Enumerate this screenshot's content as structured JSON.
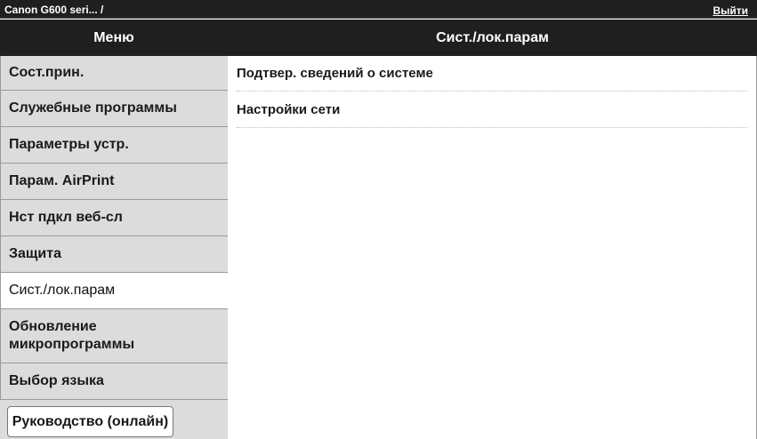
{
  "topbar": {
    "breadcrumb": "Canon G600 seri... /",
    "logout_label": "Выйти"
  },
  "header": {
    "menu_title": "Меню",
    "page_title": "Сист./лок.парам"
  },
  "sidebar": {
    "items": [
      {
        "label": "Сост.прин."
      },
      {
        "label": "Служебные программы"
      },
      {
        "label": "Параметры устр."
      },
      {
        "label": "Парам. AirPrint"
      },
      {
        "label": "Нст пдкл веб-сл"
      },
      {
        "label": "Защита"
      },
      {
        "label": "Сист./лок.парам",
        "active": true
      },
      {
        "label": "Обновление микропрограммы"
      },
      {
        "label": "Выбор языка"
      }
    ],
    "manual_button": "Руководство (онлайн)"
  },
  "main": {
    "items": [
      {
        "label": "Подтвер. сведений о системе"
      },
      {
        "label": "Настройки сети"
      }
    ]
  },
  "colors": {
    "header_bg": "#1f1f1f",
    "sidebar_bg": "#dcdcdc",
    "active_bg": "#ffffff"
  }
}
